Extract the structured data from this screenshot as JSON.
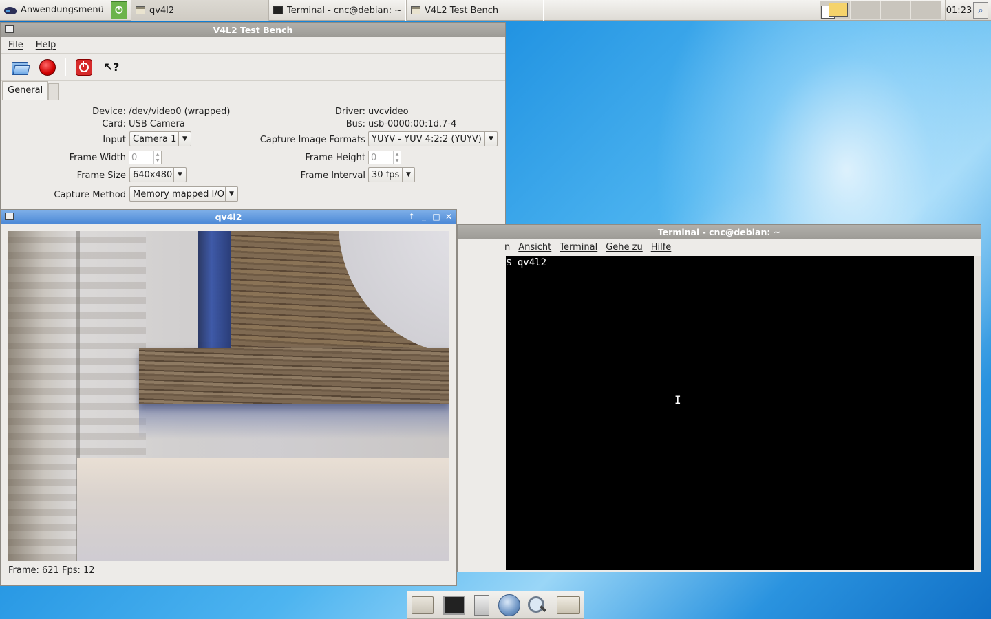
{
  "taskbar": {
    "app_menu_label": "Anwendungsmenü",
    "tasks": [
      {
        "label": "qv4l2",
        "icon": "window-icon"
      },
      {
        "label": "Terminal - cnc@debian: ~",
        "icon": "terminal-icon"
      },
      {
        "label": "V4L2 Test Bench",
        "icon": "window-icon"
      }
    ],
    "clock": "01:23"
  },
  "bench": {
    "title": "V4L2 Test Bench",
    "menu": [
      "File",
      "Help"
    ],
    "tabs": [
      "General"
    ],
    "device_label": "Device:",
    "device_value": "/dev/video0 (wrapped)",
    "card_label": "Card:",
    "card_value": "USB Camera",
    "driver_label": "Driver:",
    "driver_value": "uvcvideo",
    "bus_label": "Bus:",
    "bus_value": "usb-0000:00:1d.7-4",
    "input_label": "Input",
    "input_value": "Camera 1",
    "formats_label": "Capture Image Formats",
    "formats_value": "YUYV - YUV 4:2:2 (YUYV)",
    "frame_width_label": "Frame Width",
    "frame_width_value": "0",
    "frame_height_label": "Frame Height",
    "frame_height_value": "0",
    "frame_size_label": "Frame Size",
    "frame_size_value": "640x480",
    "frame_interval_label": "Frame Interval",
    "frame_interval_value": "30 fps",
    "capture_method_label": "Capture Method",
    "capture_method_value": "Memory mapped I/O"
  },
  "capture": {
    "title": "qv4l2",
    "status": "Frame: 621 Fps: 12"
  },
  "terminal": {
    "title": "Terminal - cnc@debian: ~",
    "menu": [
      "n",
      "Ansicht",
      "Terminal",
      "Gehe zu",
      "Hilfe"
    ],
    "prompt_line": "$ qv4l2"
  }
}
